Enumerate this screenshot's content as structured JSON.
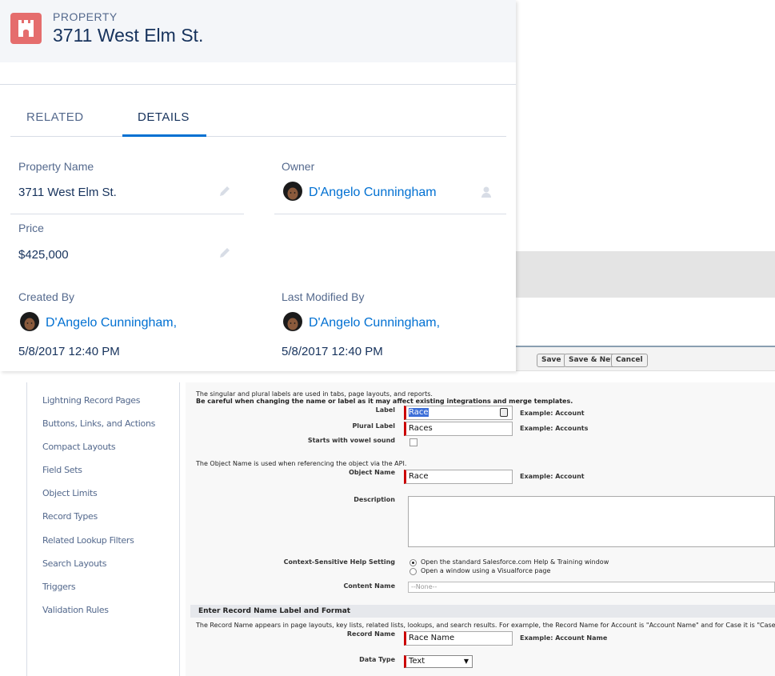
{
  "record": {
    "object_label": "PROPERTY",
    "title": "3711 West Elm St.",
    "tabs": [
      {
        "label": "RELATED",
        "active": false
      },
      {
        "label": "DETAILS",
        "active": true
      }
    ],
    "fields": {
      "property_name": {
        "label": "Property Name",
        "value": "3711 West Elm St."
      },
      "owner": {
        "label": "Owner",
        "value": "D'Angelo Cunningham"
      },
      "price": {
        "label": "Price",
        "value": "$425,000"
      },
      "created_by": {
        "label": "Created By",
        "user": "D'Angelo Cunningham,",
        "date": "5/8/2017 12:40 PM"
      },
      "last_modified_by": {
        "label": "Last Modified By",
        "user": "D'Angelo Cunningham,",
        "date": "5/8/2017 12:40 PM"
      }
    },
    "colors": {
      "icon_bg": "#e56d6d",
      "link": "#0070d2",
      "active_tab": "#0070d2"
    }
  },
  "classic": {
    "buttons": [
      "Save",
      "Save & New",
      "Cancel"
    ],
    "sidebar_items": [
      "Lightning Record Pages",
      "Buttons, Links, and Actions",
      "Compact Layouts",
      "Field Sets",
      "Object Limits",
      "Record Types",
      "Related Lookup Filters",
      "Search Layouts",
      "Triggers",
      "Validation Rules"
    ],
    "form": {
      "intro_line1": "The singular and plural labels are used in tabs, page layouts, and reports.",
      "intro_line2": "Be careful when changing the name or label as it may affect existing integrations and merge templates.",
      "label": {
        "label": "Label",
        "value": "Race",
        "example": "Example:  Account"
      },
      "plural_label": {
        "label": "Plural Label",
        "value": "Races",
        "example": "Example:  Accounts"
      },
      "vowel": {
        "label": "Starts with vowel sound"
      },
      "object_name_note": "The Object Name is used when referencing the object via the API.",
      "object_name": {
        "label": "Object Name",
        "value": "Race",
        "example": "Example:  Account"
      },
      "description": {
        "label": "Description"
      },
      "help_setting": {
        "label": "Context-Sensitive Help Setting",
        "option1": "Open the standard Salesforce.com Help & Training window",
        "option2": "Open a window using a Visualforce page"
      },
      "content_name": {
        "label": "Content Name",
        "value": "--None--"
      },
      "section_title": "Enter Record Name Label and Format",
      "record_name_note": "The Record Name appears in page layouts, key lists, related lists, lookups, and search results. For example, the Record Name for Account is \"Account Name\" and for Case it is \"Case",
      "record_name": {
        "label": "Record Name",
        "value": "Race Name",
        "example": "Example:  Account Name"
      },
      "data_type": {
        "label": "Data Type",
        "value": "Text"
      }
    }
  }
}
